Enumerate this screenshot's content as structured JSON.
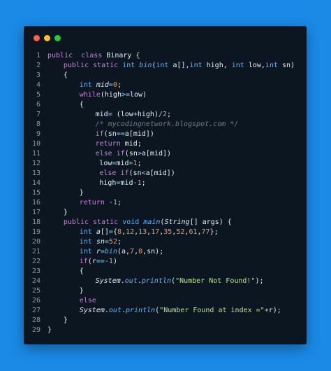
{
  "window": {
    "controls": [
      {
        "name": "close",
        "color": "#ff5f57"
      },
      {
        "name": "minimize",
        "color": "#febc2e"
      },
      {
        "name": "maximize",
        "color": "#28c840"
      }
    ]
  },
  "code_lines": [
    {
      "n": "1",
      "indent": 0,
      "tokens": [
        [
          "kw",
          "public"
        ],
        [
          "",
          "  "
        ],
        [
          "kw",
          "class"
        ],
        [
          "",
          " Binary {"
        ]
      ]
    },
    {
      "n": "2",
      "indent": 4,
      "tokens": [
        [
          "kw",
          "public"
        ],
        [
          "",
          " "
        ],
        [
          "kw",
          "static"
        ],
        [
          "",
          " "
        ],
        [
          "ty",
          "int"
        ],
        [
          "",
          " "
        ],
        [
          "fn",
          "bin"
        ],
        [
          "",
          "("
        ],
        [
          "ty",
          "int"
        ],
        [
          "",
          " a[],"
        ],
        [
          "ty",
          "int"
        ],
        [
          "",
          " high, "
        ],
        [
          "ty",
          "int"
        ],
        [
          "",
          " low,"
        ],
        [
          "ty",
          "int"
        ],
        [
          "",
          " sn)"
        ]
      ]
    },
    {
      "n": "3",
      "indent": 4,
      "tokens": [
        [
          "",
          "{"
        ]
      ]
    },
    {
      "n": "4",
      "indent": 8,
      "tokens": [
        [
          "ty",
          "int"
        ],
        [
          "",
          " "
        ],
        [
          "it",
          "mid"
        ],
        [
          "op",
          "="
        ],
        [
          "num",
          "0"
        ],
        [
          "",
          ";"
        ]
      ]
    },
    {
      "n": "5",
      "indent": 8,
      "tokens": [
        [
          "kw",
          "while"
        ],
        [
          "",
          "(high"
        ],
        [
          "op",
          ">="
        ],
        [
          "",
          "low)"
        ]
      ]
    },
    {
      "n": "6",
      "indent": 8,
      "tokens": [
        [
          "",
          "{"
        ]
      ]
    },
    {
      "n": "7",
      "indent": 12,
      "tokens": [
        [
          "",
          "mid"
        ],
        [
          "op",
          "="
        ],
        [
          "",
          " (low"
        ],
        [
          "op",
          "+"
        ],
        [
          "",
          "high)"
        ],
        [
          "op",
          "/"
        ],
        [
          "num",
          "2"
        ],
        [
          "",
          ";"
        ]
      ]
    },
    {
      "n": "8",
      "indent": 12,
      "tokens": [
        [
          "cm",
          "/* mycodingnetwork.blogspot.com */"
        ]
      ]
    },
    {
      "n": "9",
      "indent": 12,
      "tokens": [
        [
          "kw",
          "if"
        ],
        [
          "",
          "(sn"
        ],
        [
          "op",
          "=="
        ],
        [
          "",
          "a[mid])"
        ]
      ]
    },
    {
      "n": "10",
      "indent": 12,
      "tokens": [
        [
          "kw",
          "return"
        ],
        [
          "",
          " mid;"
        ]
      ]
    },
    {
      "n": "11",
      "indent": 12,
      "tokens": [
        [
          "kw",
          "else"
        ],
        [
          "",
          " "
        ],
        [
          "kw",
          "if"
        ],
        [
          "",
          "(sn"
        ],
        [
          "op",
          ">"
        ],
        [
          "",
          "a[mid])"
        ]
      ]
    },
    {
      "n": "12",
      "indent": 13,
      "tokens": [
        [
          "",
          "low"
        ],
        [
          "op",
          "="
        ],
        [
          "",
          "mid"
        ],
        [
          "op",
          "+"
        ],
        [
          "num",
          "1"
        ],
        [
          "",
          ";"
        ]
      ]
    },
    {
      "n": "13",
      "indent": 13,
      "tokens": [
        [
          "kw",
          "else"
        ],
        [
          "",
          " "
        ],
        [
          "kw",
          "if"
        ],
        [
          "",
          "(sn"
        ],
        [
          "op",
          "<"
        ],
        [
          "",
          "a[mid])"
        ]
      ]
    },
    {
      "n": "14",
      "indent": 13,
      "tokens": [
        [
          "",
          "high"
        ],
        [
          "op",
          "="
        ],
        [
          "",
          "mid"
        ],
        [
          "op",
          "-"
        ],
        [
          "num",
          "1"
        ],
        [
          "",
          ";"
        ]
      ]
    },
    {
      "n": "15",
      "indent": 8,
      "tokens": [
        [
          "",
          "}"
        ]
      ]
    },
    {
      "n": "16",
      "indent": 8,
      "tokens": [
        [
          "kw",
          "return"
        ],
        [
          "",
          " "
        ],
        [
          "op",
          "-"
        ],
        [
          "num",
          "1"
        ],
        [
          "",
          ";"
        ]
      ]
    },
    {
      "n": "17",
      "indent": 4,
      "tokens": [
        [
          "",
          "}"
        ]
      ]
    },
    {
      "n": "18",
      "indent": 4,
      "tokens": [
        [
          "kw",
          "public"
        ],
        [
          "",
          " "
        ],
        [
          "kw",
          "static"
        ],
        [
          "",
          " "
        ],
        [
          "ty",
          "void"
        ],
        [
          "",
          " "
        ],
        [
          "fn",
          "main"
        ],
        [
          "",
          "("
        ],
        [
          "it",
          "String"
        ],
        [
          "",
          "[] args) {"
        ]
      ]
    },
    {
      "n": "19",
      "indent": 8,
      "tokens": [
        [
          "ty",
          "int"
        ],
        [
          "",
          " "
        ],
        [
          "it",
          "a"
        ],
        [
          "",
          "[]"
        ],
        [
          "op",
          "="
        ],
        [
          "",
          "{"
        ],
        [
          "num",
          "8"
        ],
        [
          "",
          ","
        ],
        [
          "num",
          "12"
        ],
        [
          "",
          ","
        ],
        [
          "num",
          "13"
        ],
        [
          "",
          ","
        ],
        [
          "num",
          "17"
        ],
        [
          "",
          ","
        ],
        [
          "num",
          "35"
        ],
        [
          "",
          ","
        ],
        [
          "num",
          "52"
        ],
        [
          "",
          ","
        ],
        [
          "num",
          "61"
        ],
        [
          "",
          ","
        ],
        [
          "num",
          "77"
        ],
        [
          "",
          "};"
        ]
      ]
    },
    {
      "n": "20",
      "indent": 8,
      "tokens": [
        [
          "ty",
          "int"
        ],
        [
          "",
          " "
        ],
        [
          "it",
          "sn"
        ],
        [
          "op",
          "="
        ],
        [
          "num",
          "52"
        ],
        [
          "",
          ";"
        ]
      ]
    },
    {
      "n": "21",
      "indent": 8,
      "tokens": [
        [
          "ty",
          "int"
        ],
        [
          "",
          " "
        ],
        [
          "it",
          "r"
        ],
        [
          "op",
          "="
        ],
        [
          "fn",
          "bin"
        ],
        [
          "",
          "(a,"
        ],
        [
          "num",
          "7"
        ],
        [
          "",
          ","
        ],
        [
          "num",
          "0"
        ],
        [
          "",
          ",sn);"
        ]
      ]
    },
    {
      "n": "22",
      "indent": 8,
      "tokens": [
        [
          "kw",
          "if"
        ],
        [
          "",
          "(r"
        ],
        [
          "op",
          "=="
        ],
        [
          "op",
          "-"
        ],
        [
          "num",
          "1"
        ],
        [
          "",
          ")"
        ]
      ]
    },
    {
      "n": "23",
      "indent": 8,
      "tokens": [
        [
          "",
          "{"
        ]
      ]
    },
    {
      "n": "24",
      "indent": 12,
      "tokens": [
        [
          "it",
          "System"
        ],
        [
          "",
          "."
        ],
        [
          "fn",
          "out"
        ],
        [
          "",
          "."
        ],
        [
          "fn",
          "println"
        ],
        [
          "",
          "("
        ],
        [
          "str",
          "\"Number Not Found!\""
        ],
        [
          "",
          ");"
        ]
      ]
    },
    {
      "n": "25",
      "indent": 8,
      "tokens": [
        [
          "",
          "}"
        ]
      ]
    },
    {
      "n": "26",
      "indent": 8,
      "tokens": [
        [
          "kw",
          "else"
        ]
      ]
    },
    {
      "n": "27",
      "indent": 8,
      "tokens": [
        [
          "it",
          "System"
        ],
        [
          "",
          "."
        ],
        [
          "fn",
          "out"
        ],
        [
          "",
          "."
        ],
        [
          "fn",
          "println"
        ],
        [
          "",
          "("
        ],
        [
          "str",
          "\"Number Found at index =\""
        ],
        [
          "op",
          "+"
        ],
        [
          "",
          "r);"
        ]
      ]
    },
    {
      "n": "28",
      "indent": 4,
      "tokens": [
        [
          "",
          "}"
        ]
      ]
    },
    {
      "n": "29",
      "indent": 0,
      "tokens": [
        [
          "",
          "}"
        ]
      ]
    }
  ]
}
